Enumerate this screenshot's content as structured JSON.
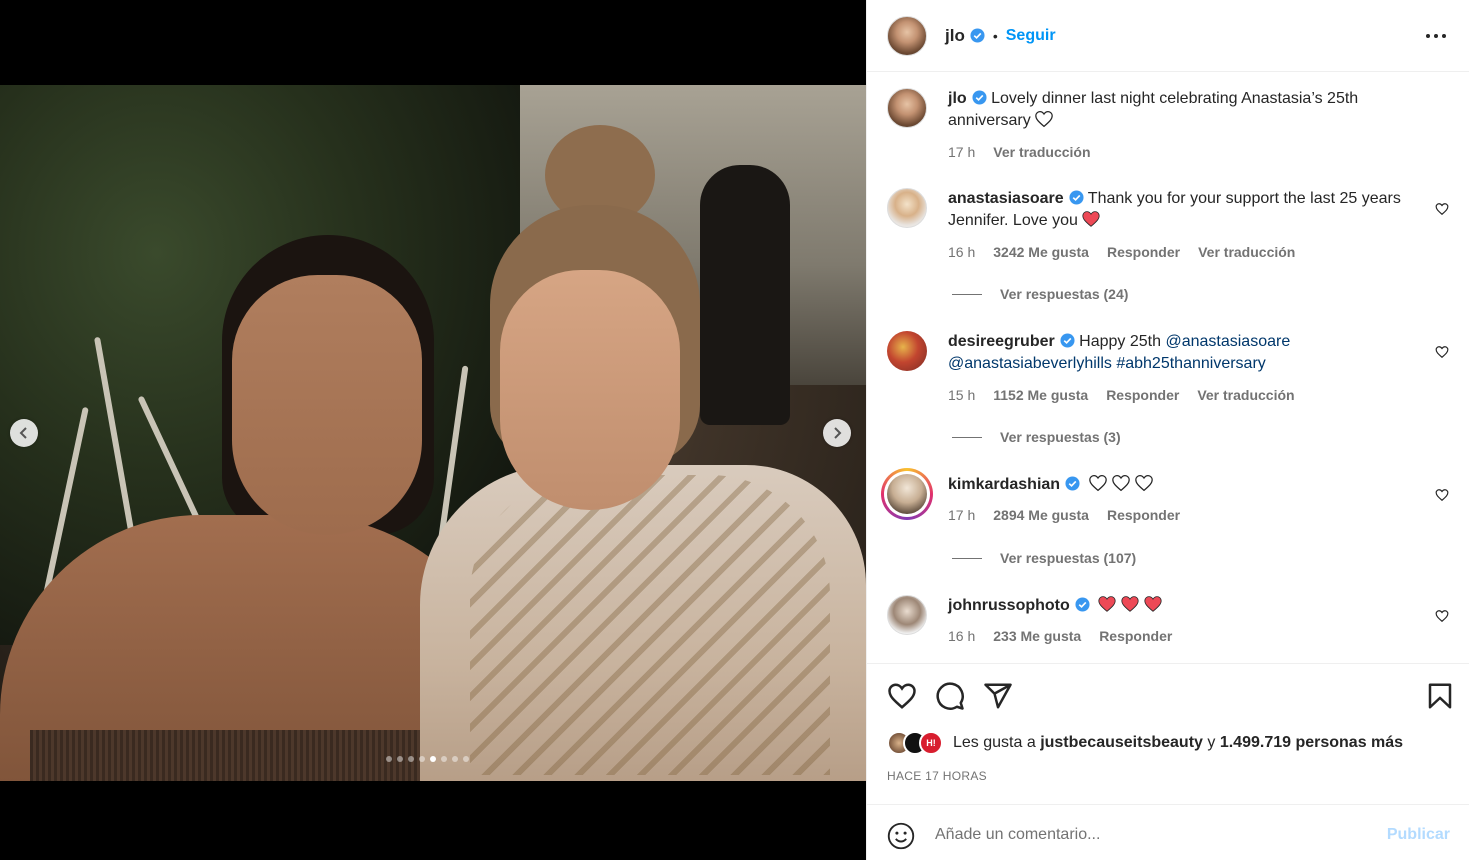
{
  "post": {
    "author": "jlo",
    "follow_label": "Seguir",
    "bullet": "•",
    "carousel": {
      "dot_count": 8,
      "active_index": 4
    },
    "caption": {
      "username": "jlo",
      "text": "Lovely dinner last night celebrating Anastasia’s 25th anniversary",
      "time": "17 h",
      "translate": "Ver traducción"
    }
  },
  "comments": [
    {
      "username": "anastasiasoare",
      "text": "Thank you for your support the last 25 years Jennifer. Love you",
      "time": "16 h",
      "likes": "3242 Me gusta",
      "reply": "Responder",
      "translate": "Ver traducción",
      "replies": "Ver respuestas (24)"
    },
    {
      "username": "desireegruber",
      "text_prefix": "Happy 25th",
      "mention1": "@anastasiasoare",
      "mention2": "@anastasiabeverlyhills",
      "hashtag": "#abh25thanniversary",
      "time": "15 h",
      "likes": "1152 Me gusta",
      "reply": "Responder",
      "translate": "Ver traducción",
      "replies": "Ver respuestas (3)"
    },
    {
      "username": "kimkardashian",
      "time": "17 h",
      "likes": "2894 Me gusta",
      "reply": "Responder",
      "replies": "Ver respuestas (107)"
    },
    {
      "username": "johnrussophoto",
      "time": "16 h",
      "likes": "233 Me gusta",
      "reply": "Responder"
    }
  ],
  "likes_summary": {
    "prefix": "Les gusta a",
    "user": "justbecauseitsbeauty",
    "connector": "y",
    "others": "1.499.719 personas más",
    "mini_badge": "H!"
  },
  "time_ago": "HACE 17 HORAS",
  "add_comment": {
    "placeholder": "Añade un comentario...",
    "publish": "Publicar"
  },
  "colors": {
    "accent": "#0095f6",
    "verified": "#3897f0",
    "heart_red": "#ed4956",
    "link": "#00376b",
    "publish_disabled": "#b3dbff"
  },
  "icons": [
    "chevron-left-icon",
    "chevron-right-icon",
    "verified-badge-icon",
    "more-icon",
    "heart-icon",
    "comment-icon",
    "share-icon",
    "bookmark-icon",
    "emoji-icon"
  ]
}
